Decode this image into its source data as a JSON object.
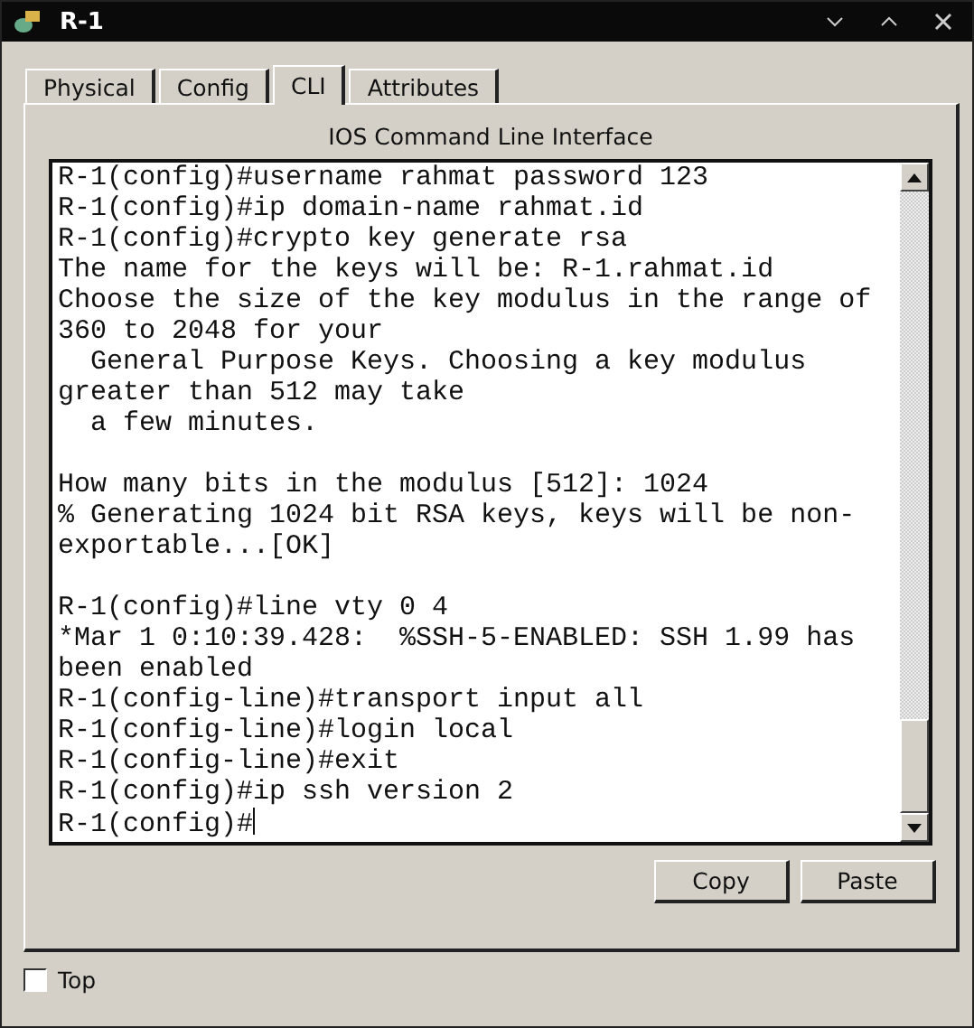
{
  "window": {
    "title": "R-1"
  },
  "tabs": [
    {
      "label": "Physical",
      "selected": false
    },
    {
      "label": "Config",
      "selected": false
    },
    {
      "label": "CLI",
      "selected": true
    },
    {
      "label": "Attributes",
      "selected": false
    }
  ],
  "panel_title": "IOS Command Line Interface",
  "terminal": [
    {
      "kind": "text",
      "text": "R-1(config)#username rahmat password 123"
    },
    {
      "kind": "text",
      "text": "R-1(config)#ip domain-name rahmat.id"
    },
    {
      "kind": "text",
      "text": "R-1(config)#crypto key generate rsa"
    },
    {
      "kind": "text",
      "text": "The name for the keys will be: R-1.rahmat.id"
    },
    {
      "kind": "text",
      "text": "Choose the size of the key modulus in the range of"
    },
    {
      "kind": "text",
      "text": "360 to 2048 for your"
    },
    {
      "kind": "text",
      "text": "  General Purpose Keys. Choosing a key modulus"
    },
    {
      "kind": "text",
      "text": "greater than 512 may take"
    },
    {
      "kind": "text",
      "text": "  a few minutes."
    },
    {
      "kind": "blank"
    },
    {
      "kind": "text",
      "text": "How many bits in the modulus [512]: 1024"
    },
    {
      "kind": "text",
      "text": "% Generating 1024 bit RSA keys, keys will be non-"
    },
    {
      "kind": "text",
      "text": "exportable...[OK]"
    },
    {
      "kind": "blank"
    },
    {
      "kind": "text",
      "text": "R-1(config)#line vty 0 4"
    },
    {
      "kind": "text",
      "text": "*Mar 1 0:10:39.428:  %SSH-5-ENABLED: SSH 1.99 has"
    },
    {
      "kind": "text",
      "text": "been enabled"
    },
    {
      "kind": "text",
      "text": "R-1(config-line)#transport input all"
    },
    {
      "kind": "text",
      "text": "R-1(config-line)#login local"
    },
    {
      "kind": "text",
      "text": "R-1(config-line)#exit"
    },
    {
      "kind": "text",
      "text": "R-1(config)#ip ssh version 2"
    },
    {
      "kind": "prompt",
      "text": "R-1(config)#"
    }
  ],
  "buttons": [
    "Copy",
    "Paste"
  ],
  "top_checkbox": {
    "label": "Top",
    "checked": false
  }
}
